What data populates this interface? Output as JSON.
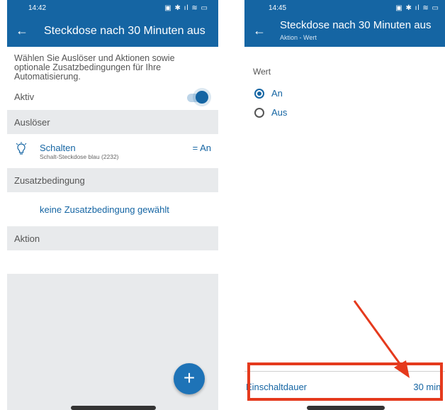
{
  "left": {
    "status_time": "14:42",
    "status_icons": "▣ ✱ ıl ≋ ▭",
    "title": "Steckdose nach 30 Minuten aus",
    "description": "Wählen Sie Auslöser und Aktionen sowie optionale Zusatzbedingungen für Ihre Automatisierung.",
    "aktiv_label": "Aktiv",
    "aktiv_on": true,
    "section_trigger": "Auslöser",
    "trigger": {
      "name": "Schalten",
      "device": "Schalt-Steckdose blau (2232)",
      "value": "= An",
      "icon": "lightbulb-icon"
    },
    "section_condition": "Zusatzbedingung",
    "condition_link": "keine Zusatzbedingung gewählt",
    "section_action": "Aktion",
    "fab_label": "+"
  },
  "right": {
    "status_time": "14:45",
    "status_icons": "▣ ✱ ıl ≋ ▭",
    "title": "Steckdose nach 30 Minuten aus",
    "subtitle": "Aktion - Wert",
    "wert_label": "Wert",
    "options": [
      {
        "label": "An",
        "selected": true
      },
      {
        "label": "Aus",
        "selected": false
      }
    ],
    "duration_label": "Einschaltdauer",
    "duration_value": "30 min."
  },
  "colors": {
    "primary": "#1565a3",
    "section_bg": "#e8eaec",
    "annotation": "#e53a1d"
  }
}
